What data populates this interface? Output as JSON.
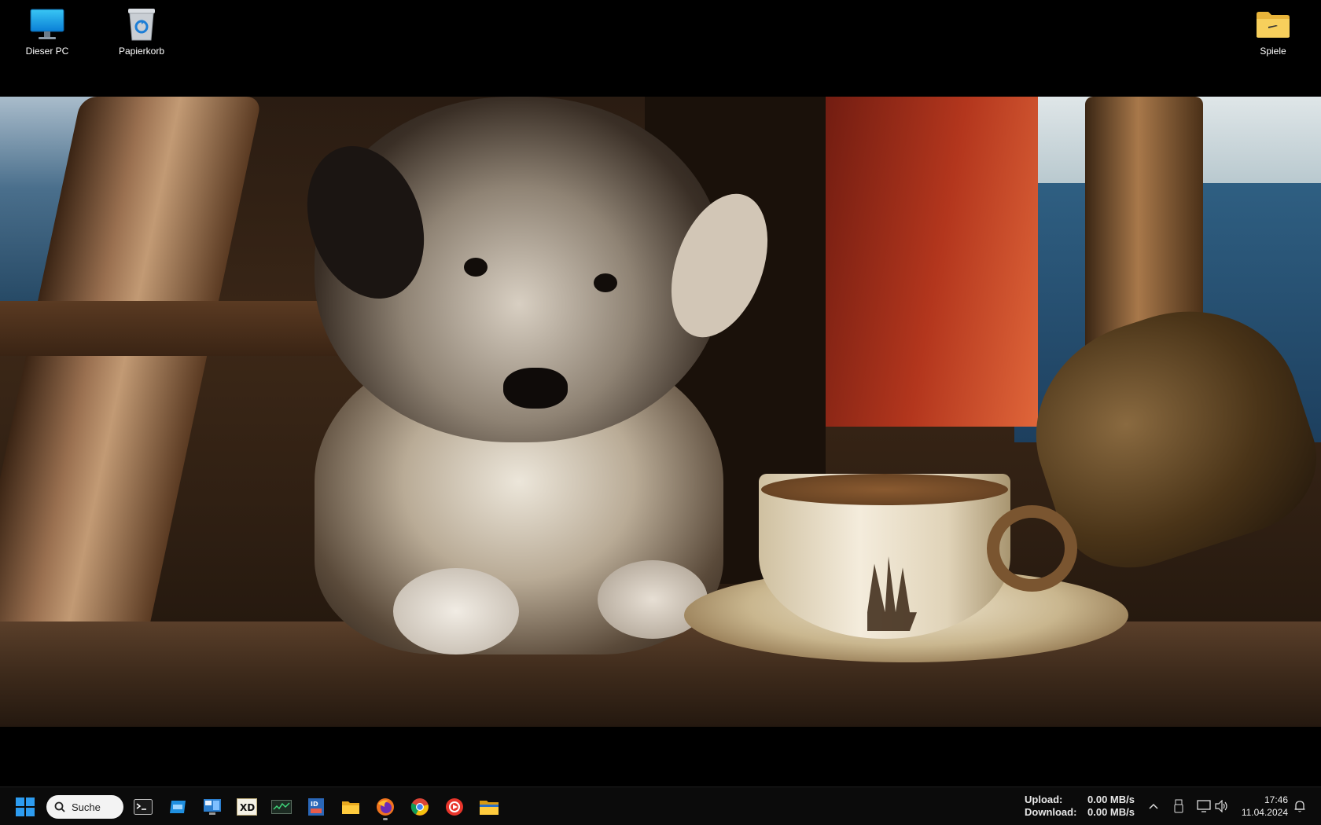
{
  "desktop": {
    "icons": [
      {
        "label": "Dieser PC",
        "icon": "monitor-icon"
      },
      {
        "label": "Papierkorb",
        "icon": "recycle-bin-icon"
      },
      {
        "label": "Spiele",
        "icon": "folder-icon"
      }
    ],
    "wallpaper": "puppy-with-teacup-on-pirate-ship"
  },
  "taskbar": {
    "start_icon": "windows-start-icon",
    "search_label": "Suche",
    "apps": [
      {
        "name": "terminal",
        "icon": "terminal-icon"
      },
      {
        "name": "app-blue",
        "icon": "blue-window-icon"
      },
      {
        "name": "control-panel",
        "icon": "control-panel-icon"
      },
      {
        "name": "xd-tool",
        "icon": "xd-app-icon"
      },
      {
        "name": "monitor-tool",
        "icon": "green-chart-icon"
      },
      {
        "name": "id-app",
        "icon": "id-card-icon"
      },
      {
        "name": "file-explorer",
        "icon": "file-explorer-icon"
      },
      {
        "name": "firefox",
        "icon": "firefox-icon",
        "active": true
      },
      {
        "name": "chrome",
        "icon": "chrome-icon"
      },
      {
        "name": "red-app",
        "icon": "red-circle-app-icon"
      },
      {
        "name": "folder",
        "icon": "folder-icon"
      }
    ],
    "network": {
      "upload_label": "Upload:",
      "upload_value": "0.00 MB/s",
      "download_label": "Download:",
      "download_value": "0.00 MB/s"
    },
    "tray_icons": [
      "chevron-up-icon",
      "usb-drive-icon",
      "network-icon",
      "speaker-icon"
    ],
    "clock": {
      "time": "17:46",
      "date": "11.04.2024"
    },
    "notification_icon": "bell-icon"
  },
  "colors": {
    "taskbar_bg": "#0b0b0b",
    "desktop_bg": "#000000",
    "search_bg": "#f3f3f3"
  }
}
